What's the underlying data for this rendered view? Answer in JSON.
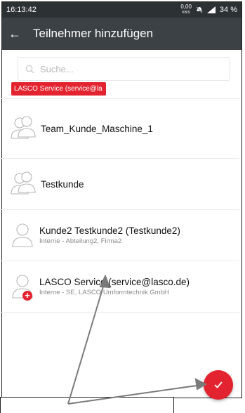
{
  "status": {
    "time": "16:13:42",
    "net_top": "0,00",
    "net_bottom": "KB/S",
    "battery": "34 %"
  },
  "appbar": {
    "title": "Teilnehmer hinzufügen"
  },
  "search": {
    "placeholder": "Suche..."
  },
  "selected_chip": {
    "label": "LASCO Service (service@la"
  },
  "participants": [
    {
      "name": "Team_Kunde_Maschine_1",
      "sub": ""
    },
    {
      "name": "Testkunde",
      "sub": ""
    },
    {
      "name": "Kunde2 Testkunde2 (Testkunde2)",
      "sub": "Interne - Abteilung2, Firma2"
    },
    {
      "name": "LASCO Service (service@lasco.de)",
      "sub": "Interne - SE, LASCO Umformtechnik GmbH"
    }
  ],
  "colors": {
    "accent": "#e3232f",
    "appbar": "#3b4145",
    "statusbar": "#2c3134"
  }
}
